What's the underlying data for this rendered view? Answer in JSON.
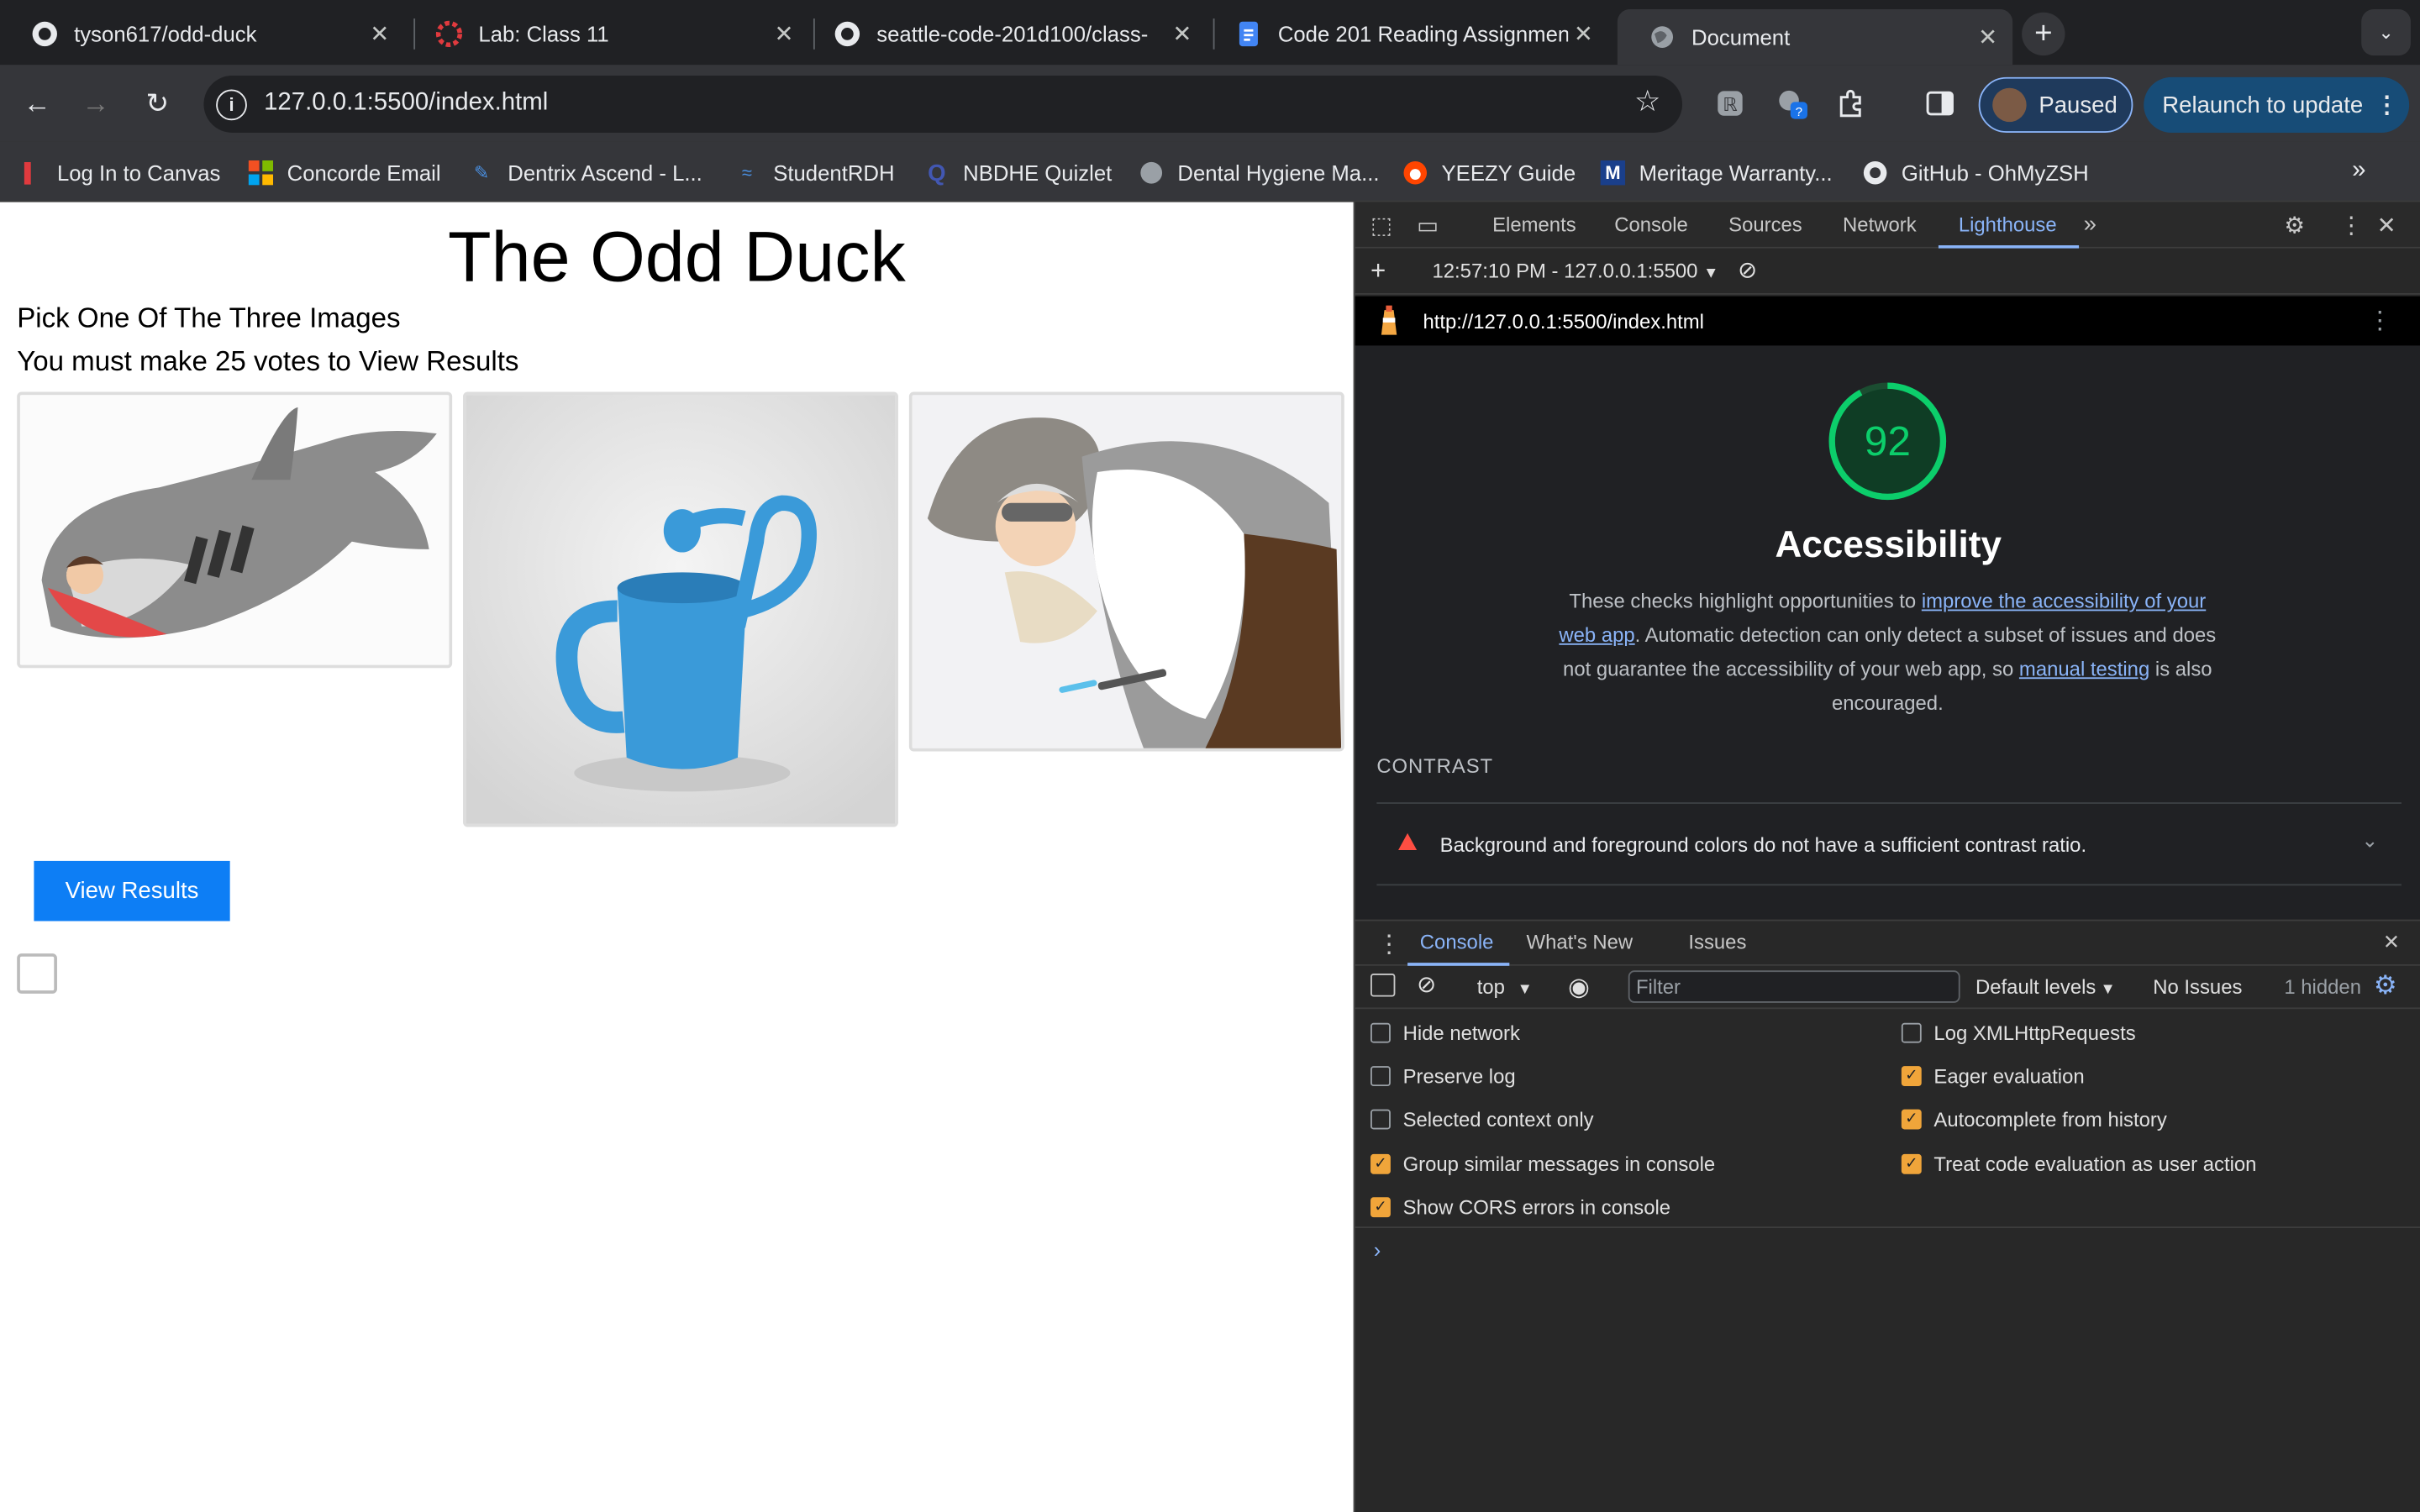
{
  "tabs": [
    {
      "title": "tyson617/odd-duck",
      "icon": "github-icon"
    },
    {
      "title": "Lab: Class 11",
      "icon": "canvas-icon"
    },
    {
      "title": "seattle-code-201d100/class-",
      "icon": "github-icon"
    },
    {
      "title": "Code 201 Reading Assignmen",
      "icon": "docs-icon"
    },
    {
      "title": "Document",
      "icon": "globe-icon",
      "active": true
    }
  ],
  "toolbar": {
    "url": "127.0.0.1:5500/index.html",
    "profile_label": "Paused",
    "relaunch_label": "Relaunch to update"
  },
  "bookmarks": [
    {
      "label": "Log In to Canvas"
    },
    {
      "label": "Concorde Email"
    },
    {
      "label": "Dentrix Ascend - L..."
    },
    {
      "label": "StudentRDH"
    },
    {
      "label": "NBDHE Quizlet"
    },
    {
      "label": "Dental Hygiene Ma..."
    },
    {
      "label": "YEEZY Guide"
    },
    {
      "label": "Meritage Warranty..."
    },
    {
      "label": "GitHub - OhMyZSH"
    }
  ],
  "page": {
    "heading": "The Odd Duck",
    "instruction1": "Pick One Of The Three Images",
    "instruction2": "You must make 25 votes to View Results",
    "view_button": "View Results"
  },
  "devtools": {
    "tabs": [
      "Elements",
      "Console",
      "Sources",
      "Network",
      "Lighthouse"
    ],
    "active_tab": "Lighthouse",
    "report_time": "12:57:10 PM - 127.0.0.1:5500",
    "report_url": "http://127.0.0.1:5500/index.html",
    "score": 92,
    "score_color": "#0cce6b",
    "category": "Accessibility",
    "desc_part1": "These checks highlight opportunities to ",
    "desc_link1": "improve the accessibility of your web app",
    "desc_part2": ". Automatic detection can only detect a subset of issues and does not guarantee the accessibility of your web app, so ",
    "desc_link2": "manual testing",
    "desc_part3": " is also encouraged.",
    "section": "CONTRAST",
    "audit": "Background and foreground colors do not have a sufficient contrast ratio."
  },
  "drawer": {
    "tabs": [
      "Console",
      "What's New",
      "Issues"
    ],
    "context": "top",
    "filter_placeholder": "Filter",
    "levels": "Default levels",
    "issues": "No Issues",
    "hidden": "1 hidden",
    "settings_left": [
      {
        "label": "Hide network",
        "checked": false
      },
      {
        "label": "Preserve log",
        "checked": false
      },
      {
        "label": "Selected context only",
        "checked": false
      },
      {
        "label": "Group similar messages in console",
        "checked": true
      },
      {
        "label": "Show CORS errors in console",
        "checked": true
      }
    ],
    "settings_right": [
      {
        "label": "Log XMLHttpRequests",
        "checked": false
      },
      {
        "label": "Eager evaluation",
        "checked": true
      },
      {
        "label": "Autocomplete from history",
        "checked": true
      },
      {
        "label": "Treat code evaluation as user action",
        "checked": true
      }
    ]
  }
}
